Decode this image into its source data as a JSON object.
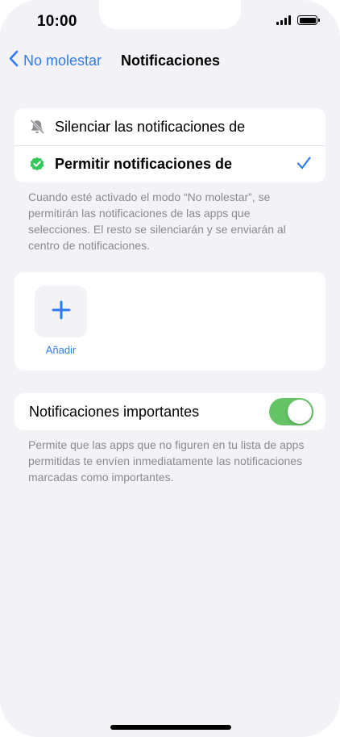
{
  "status_bar": {
    "time": "10:00",
    "icons": [
      "signal-icon",
      "battery-icon"
    ]
  },
  "nav": {
    "back_label": "No molestar",
    "title": "Notificaciones"
  },
  "options": [
    {
      "label": "Silenciar las notificaciones de",
      "icon": "bell-slash-icon",
      "selected": false
    },
    {
      "label": "Permitir notificaciones de",
      "icon": "shield-check-icon",
      "selected": true
    }
  ],
  "options_footnote": "Cuando esté activado el modo “No molestar”, se permitirán las notificaciones de las apps que selecciones. El resto se silenciarán y se enviarán al centro de notificaciones.",
  "apps": {
    "add_label": "Añadir"
  },
  "important": {
    "label": "Notificaciones importantes",
    "enabled": true,
    "footnote": "Permite que las apps que no figuren en tu lista de apps permitidas te envíen inmediatamente las notificaciones marcadas como importantes."
  },
  "colors": {
    "accent": "#2f7bf6",
    "toggle_on": "#65c466",
    "shield_green": "#34c759",
    "background": "#f2f2f7"
  }
}
